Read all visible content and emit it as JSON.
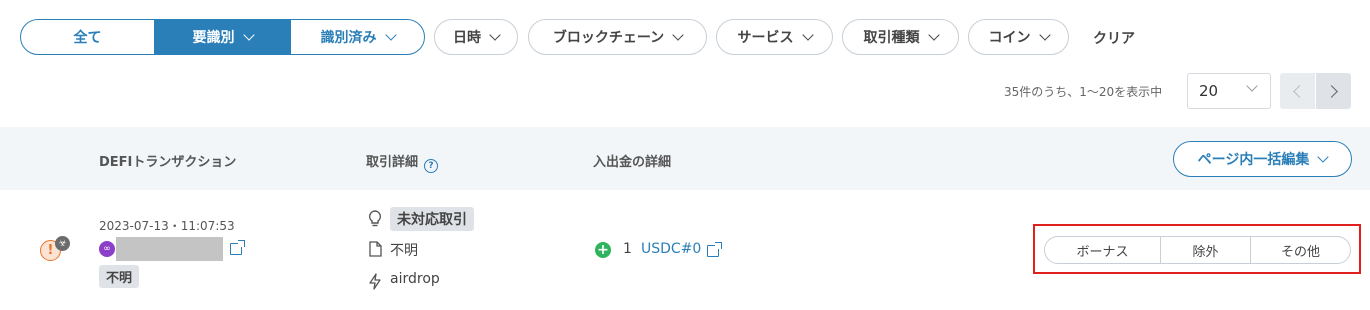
{
  "filters": {
    "segment": {
      "all": "全て",
      "needs_id": "要識別",
      "identified": "識別済み"
    },
    "pills": {
      "datetime": "日時",
      "blockchain": "ブロックチェーン",
      "service": "サービス",
      "trade_type": "取引種類",
      "coin": "コイン"
    },
    "clear": "クリア"
  },
  "pagination": {
    "count_text": "35件のうち、1〜20を表示中",
    "per_page": "20"
  },
  "table": {
    "headers": {
      "defi": "DEFIトランザクション",
      "detail": "取引詳細",
      "flow": "入出金の詳細"
    },
    "bulk_edit": "ページ内一括編集"
  },
  "row": {
    "datetime": "2023-07-13・11:07:53",
    "status_tag": "不明",
    "detail_tag": "未対応取引",
    "detail_doc": "不明",
    "detail_type": "airdrop",
    "amount": "1",
    "coin": "USDC#0",
    "choices": [
      "ボーナス",
      "除外",
      "その他"
    ]
  },
  "colors": {
    "accent": "#2b7fb8",
    "warning": "#e8722a",
    "positive": "#2fb35c",
    "highlight": "#e0201c"
  }
}
